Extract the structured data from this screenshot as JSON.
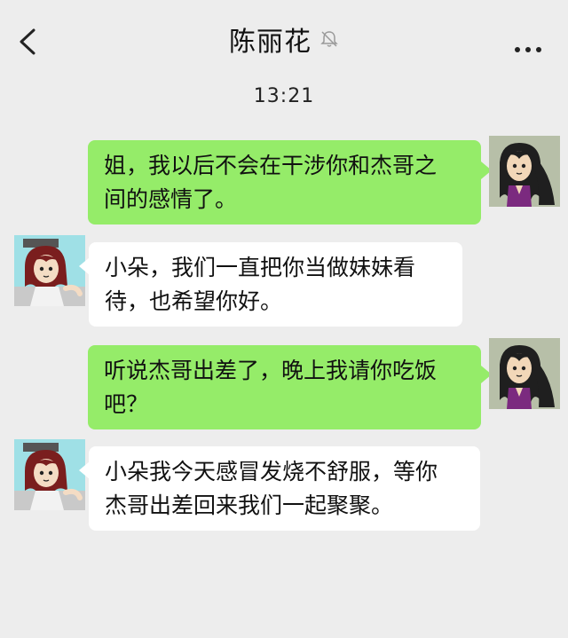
{
  "header": {
    "title": "陈丽花",
    "back_icon": "back-chevron-icon",
    "mute_icon": "bell-muted-icon",
    "more_icon": "more-dots-icon"
  },
  "timestamp": "13:21",
  "colors": {
    "background": "#ededed",
    "outgoing_bubble": "#95ec69",
    "incoming_bubble": "#ffffff"
  },
  "messages": [
    {
      "direction": "outgoing",
      "line1": "姐，我以后不会在干涉你和杰哥之",
      "line2": "间的感情了。"
    },
    {
      "direction": "incoming",
      "line1": "小朵，我们一直把你当做妹妹看",
      "line2": "待，也希望你好。"
    },
    {
      "direction": "outgoing",
      "line1": "听说杰哥出差了，晚上我请你吃饭",
      "line2": "吧？"
    },
    {
      "direction": "incoming",
      "line1": "小朵我今天感冒发烧不舒服，等你",
      "line2": "杰哥出差回来我们一起聚聚。"
    }
  ]
}
